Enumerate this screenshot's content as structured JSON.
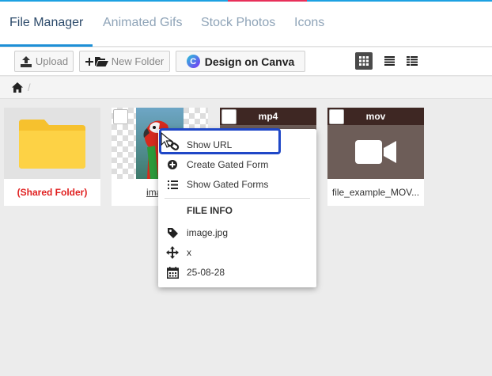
{
  "tabs": [
    {
      "label": "File Manager",
      "active": true
    },
    {
      "label": "Animated Gifs",
      "active": false
    },
    {
      "label": "Stock Photos",
      "active": false
    },
    {
      "label": "Icons",
      "active": false
    }
  ],
  "toolbar": {
    "upload_label": "Upload",
    "new_folder_label": "New Folder",
    "canva_logo_letter": "C",
    "canva_label": "Design on Canva",
    "view_modes": [
      "grid-view-icon",
      "list-view-icon",
      "detail-view-icon"
    ]
  },
  "breadcrumb": {
    "separator": "/"
  },
  "files": [
    {
      "name": "(Shared Folder)",
      "type": "folder",
      "name_color": "#e02020"
    },
    {
      "name": "image.jpg",
      "type": "image"
    },
    {
      "name": "",
      "type": "video",
      "badge": "mp4"
    },
    {
      "name": "file_example_MOV...",
      "type": "video",
      "badge": "mov"
    }
  ],
  "context_menu": {
    "items": [
      {
        "label": "Show URL",
        "icon": "link-icon"
      },
      {
        "label": "Create Gated Form",
        "icon": "plus-circle-icon"
      },
      {
        "label": "Show Gated Forms",
        "icon": "list-icon"
      }
    ],
    "info_header": "FILE INFO",
    "info": [
      {
        "value": "image.jpg",
        "icon": "tag-icon"
      },
      {
        "value": "x",
        "icon": "dimensions-icon"
      },
      {
        "value": "25-08-28",
        "icon": "calendar-icon"
      }
    ]
  },
  "colors": {
    "accent": "#1d8fd6",
    "folder": "#fdd245",
    "video_header": "#3e2723",
    "video_body": "#6d5d58",
    "highlight": "#1f47c7"
  }
}
